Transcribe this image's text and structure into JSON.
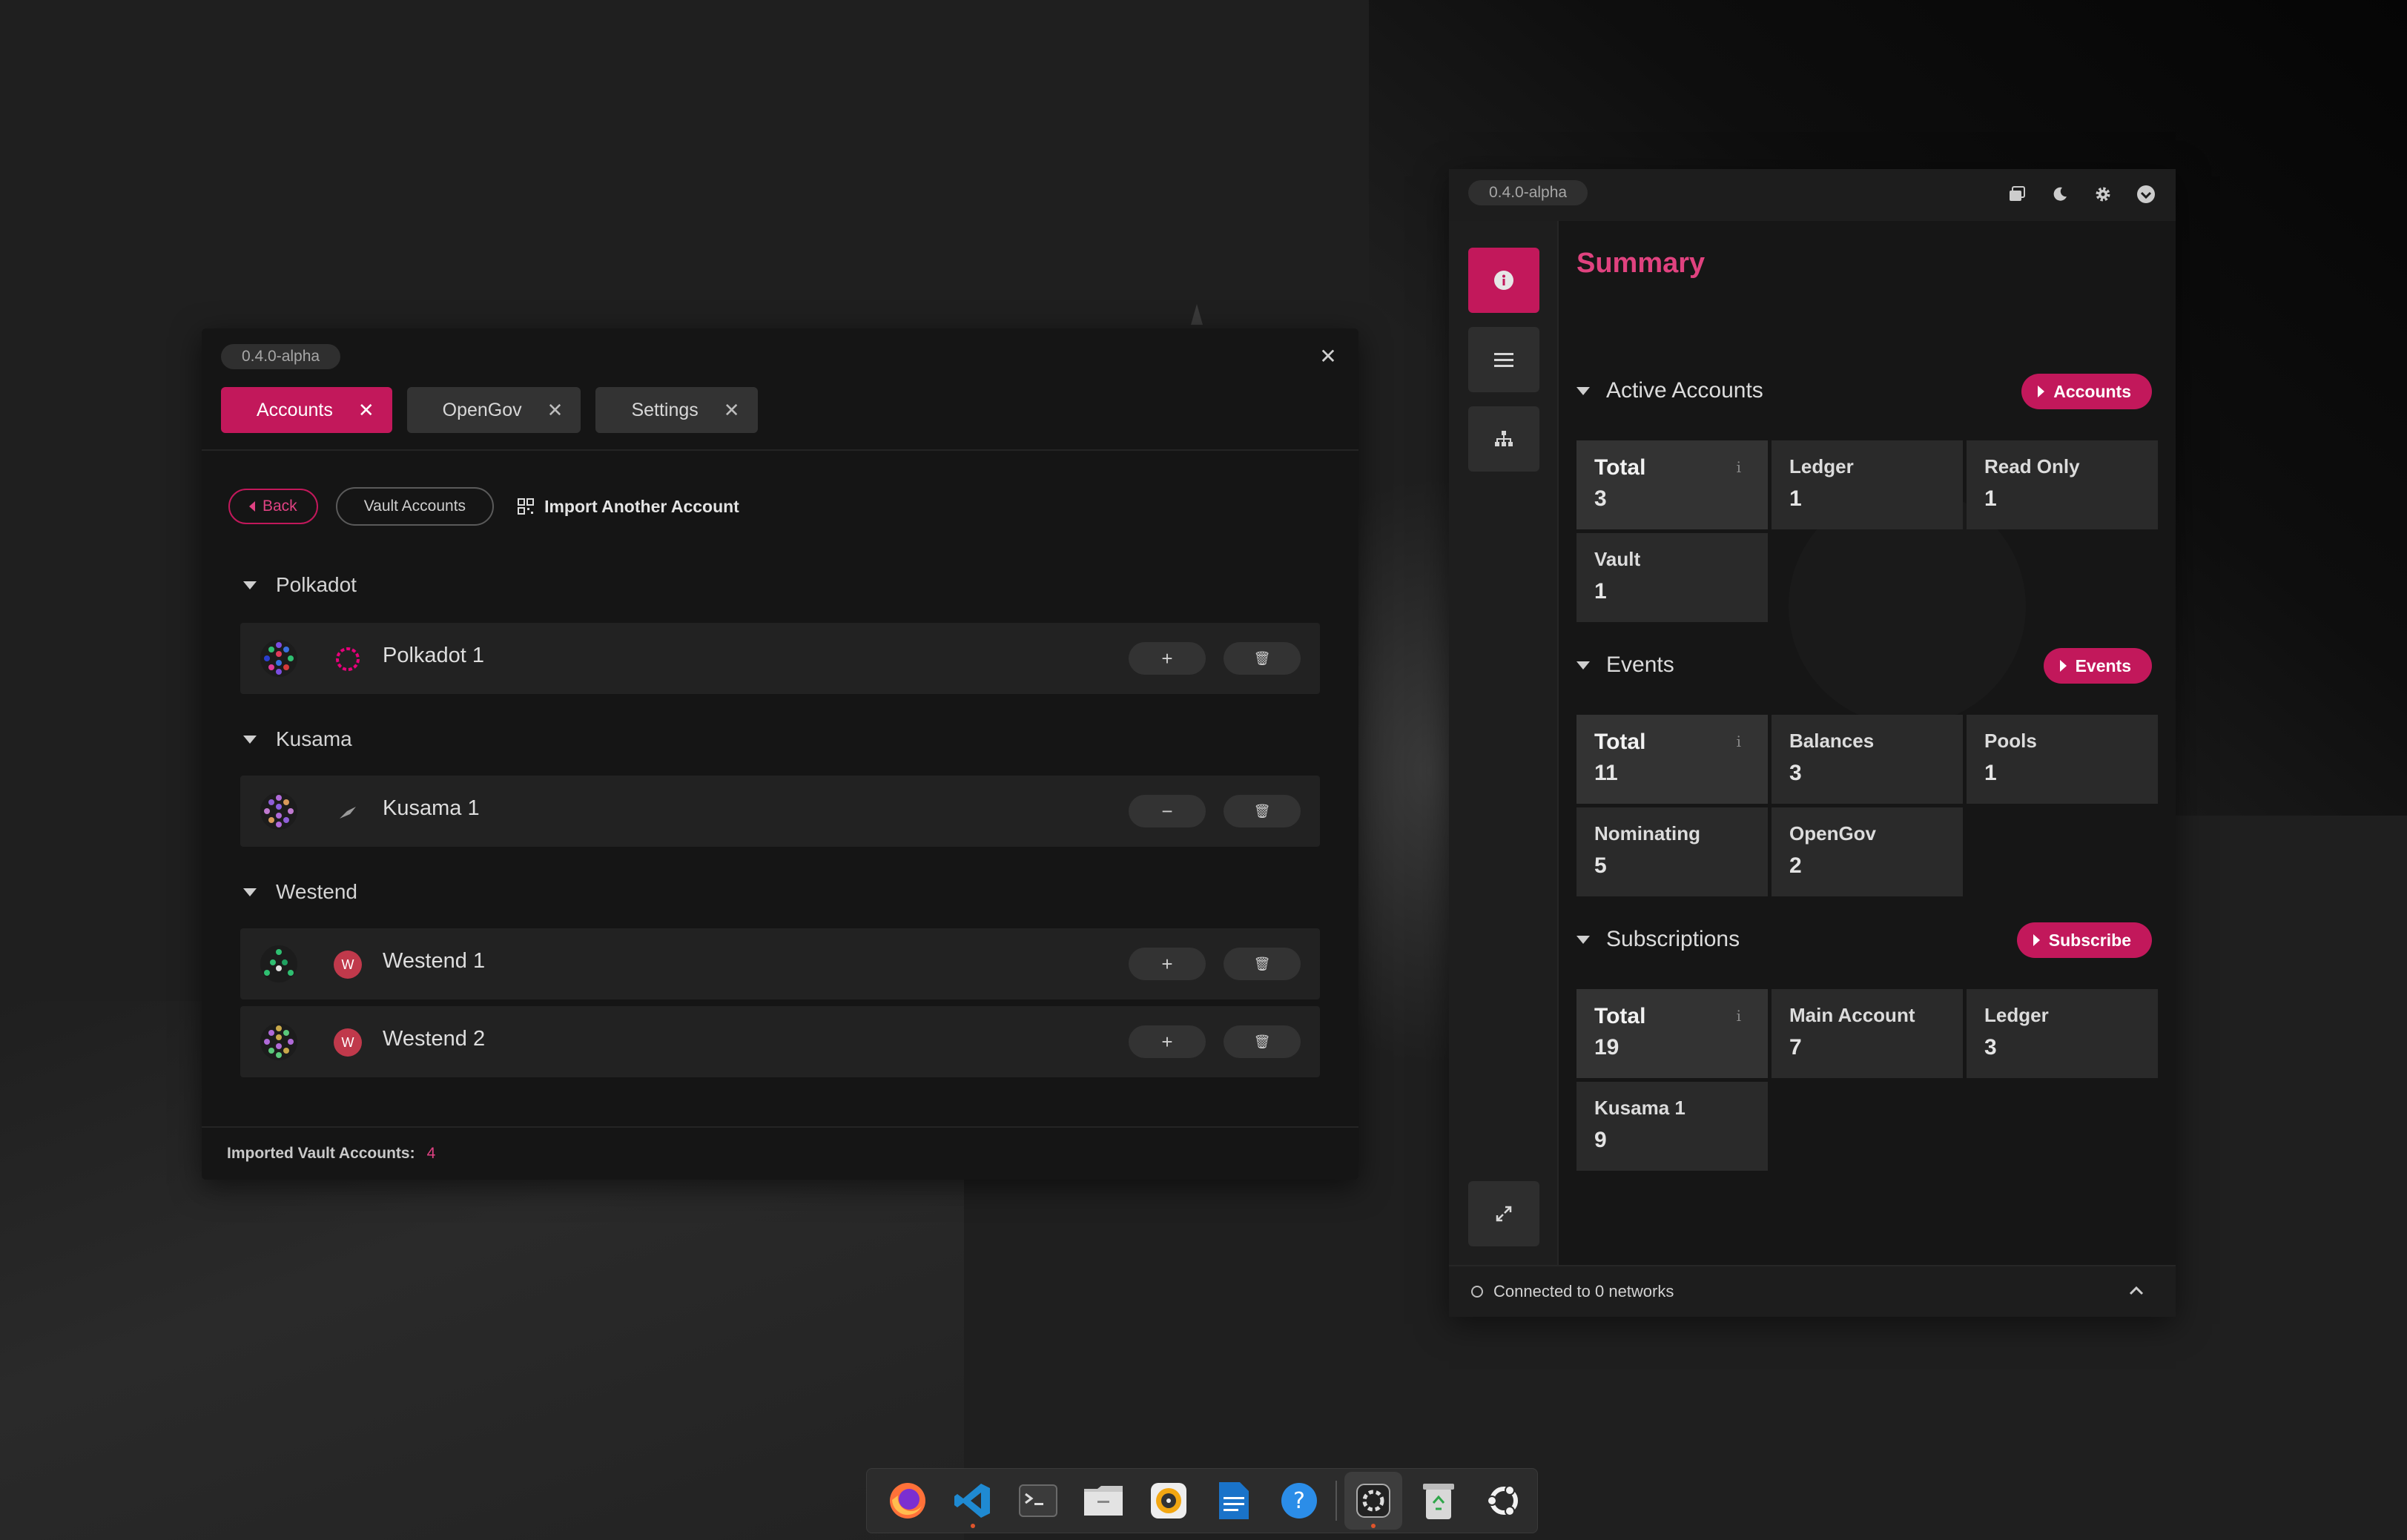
{
  "left_window": {
    "version": "0.4.0-alpha",
    "tabs": [
      {
        "label": "Accounts"
      },
      {
        "label": "OpenGov"
      },
      {
        "label": "Settings"
      }
    ],
    "toolbar": {
      "back_label": "Back",
      "vault_label": "Vault Accounts",
      "import_label": "Import Another Account"
    },
    "groups": [
      {
        "name": "Polkadot",
        "accounts": [
          {
            "name": "Polkadot 1",
            "action": "+"
          }
        ]
      },
      {
        "name": "Kusama",
        "accounts": [
          {
            "name": "Kusama 1",
            "action": "−"
          }
        ]
      },
      {
        "name": "Westend",
        "accounts": [
          {
            "name": "Westend 1",
            "action": "+"
          },
          {
            "name": "Westend 2",
            "action": "+"
          }
        ]
      }
    ],
    "footer": {
      "label": "Imported Vault Accounts:",
      "count": "4"
    }
  },
  "right_window": {
    "version": "0.4.0-alpha",
    "title": "Summary",
    "sections": {
      "active_accounts": {
        "title": "Active Accounts",
        "button": "Accounts",
        "cells": [
          {
            "label": "Total",
            "value": "3"
          },
          {
            "label": "Ledger",
            "value": "1"
          },
          {
            "label": "Read Only",
            "value": "1"
          },
          {
            "label": "Vault",
            "value": "1"
          }
        ]
      },
      "events": {
        "title": "Events",
        "button": "Events",
        "cells": [
          {
            "label": "Total",
            "value": "11"
          },
          {
            "label": "Balances",
            "value": "3"
          },
          {
            "label": "Pools",
            "value": "1"
          },
          {
            "label": "Nominating",
            "value": "5"
          },
          {
            "label": "OpenGov",
            "value": "2"
          }
        ]
      },
      "subscriptions": {
        "title": "Subscriptions",
        "button": "Subscribe",
        "cells": [
          {
            "label": "Total",
            "value": "19"
          },
          {
            "label": "Main Account",
            "value": "7"
          },
          {
            "label": "Ledger",
            "value": "3"
          },
          {
            "label": "Kusama 1",
            "value": "9"
          }
        ]
      }
    },
    "footer": {
      "status": "Connected to 0 networks"
    }
  },
  "colors": {
    "accent": "#c2185b",
    "accent_text": "#e0427f"
  },
  "dock": [
    "firefox-icon",
    "vscode-icon",
    "terminal-icon",
    "files-icon",
    "music-icon",
    "writer-icon",
    "help-icon",
    "polkadot-app-icon",
    "trash-icon",
    "ubuntu-icon"
  ]
}
